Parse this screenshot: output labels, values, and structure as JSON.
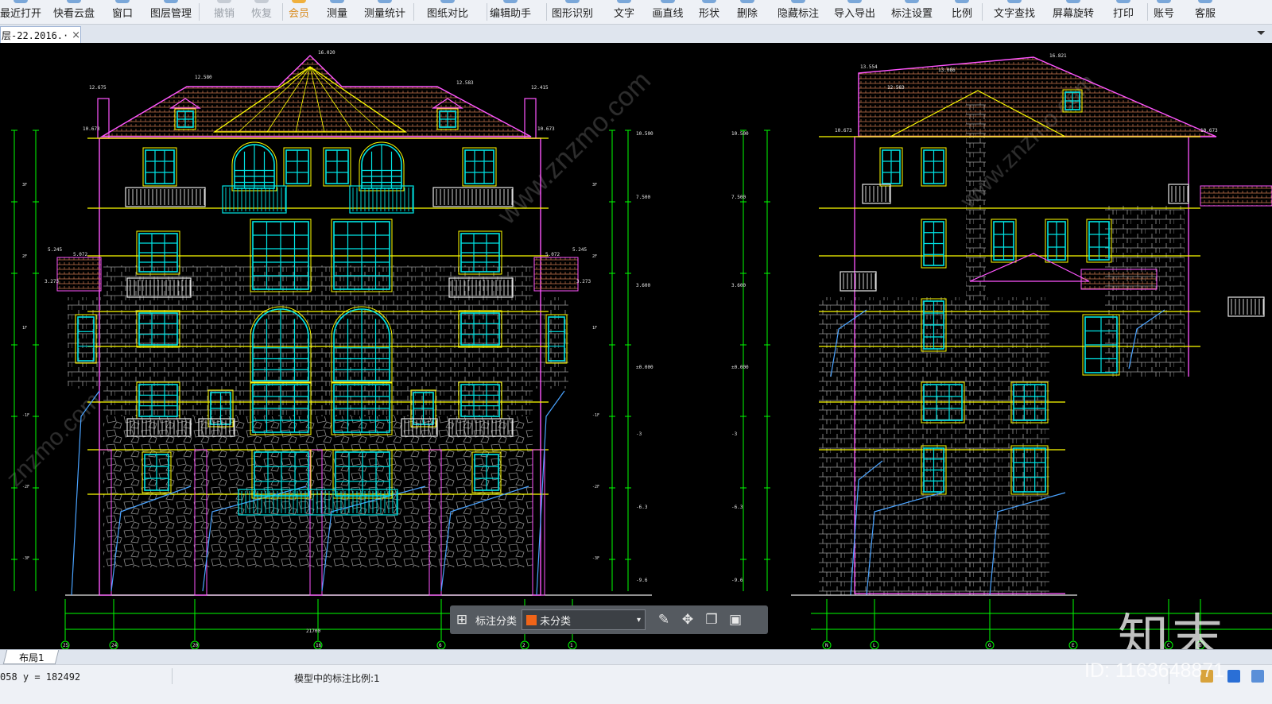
{
  "toolbar": {
    "items": [
      {
        "label": "最近打开",
        "state": "normal"
      },
      {
        "label": "快看云盘",
        "state": "normal"
      },
      {
        "label": "窗口",
        "state": "normal"
      },
      {
        "label": "图层管理",
        "state": "normal"
      },
      {
        "label": "撤销",
        "state": "disabled"
      },
      {
        "label": "恢复",
        "state": "disabled"
      },
      {
        "label": "会员",
        "state": "member"
      },
      {
        "label": "测量",
        "state": "normal"
      },
      {
        "label": "测量统计",
        "state": "normal"
      },
      {
        "label": "图纸对比",
        "state": "normal"
      },
      {
        "label": "编辑助手",
        "state": "normal"
      },
      {
        "label": "图形识别",
        "state": "normal"
      },
      {
        "label": "文字",
        "state": "normal"
      },
      {
        "label": "画直线",
        "state": "normal"
      },
      {
        "label": "形状",
        "state": "normal"
      },
      {
        "label": "删除",
        "state": "normal"
      },
      {
        "label": "隐藏标注",
        "state": "normal"
      },
      {
        "label": "导入导出",
        "state": "normal"
      },
      {
        "label": "标注设置",
        "state": "normal"
      },
      {
        "label": "比例",
        "state": "normal"
      },
      {
        "label": "文字查找",
        "state": "normal"
      },
      {
        "label": "屏幕旋转",
        "state": "normal"
      },
      {
        "label": "打印",
        "state": "normal"
      },
      {
        "label": "账号",
        "state": "normal"
      },
      {
        "label": "客服",
        "state": "normal"
      }
    ]
  },
  "tabs": {
    "document_title": "层-22.2016.·",
    "close_glyph": "×",
    "menu_glyph": "⏷"
  },
  "canvas": {
    "left_drawing_labels": {
      "roof_ridge": "16.020",
      "left_top": "12.675",
      "right_top": "12.415",
      "roof_left": "12.580",
      "roof_right": "12.583",
      "eave_left": "10.673",
      "eave_right": "10.673",
      "floor3": "10.500",
      "floor2": "7.500",
      "floor1": "3.600",
      "ground": "±0.000",
      "basement1": "-3",
      "basement2": "-6.3",
      "basement3": "-9.6",
      "side_left": "5.245",
      "side_right": "5.245",
      "balcony_left": "5.072",
      "balcony_right": "5.072",
      "low_left": "3.273",
      "low_right": "3.273",
      "bottom_width": "21700"
    },
    "right_drawing_labels": {
      "ridge": "16.821",
      "eave_top": "13.554",
      "top2": "13.086",
      "top3": "12.583",
      "left_eave": "10.673",
      "right_eave": "10.673",
      "right_dim_top": "10.500",
      "right_dim_2": "7.500",
      "right_dim_3": "3.600",
      "right_dim_4": "±0.000",
      "right_dim_5": "-3",
      "right_dim_6": "-6.3",
      "right_dim_7": "-9.6"
    },
    "left_axis_labels": [
      "25",
      "24",
      "20",
      "16",
      "6",
      "2",
      "1"
    ],
    "right_axis_labels": [
      "N",
      "L",
      "G",
      "E",
      "C",
      "B"
    ],
    "side_axis_labels": [
      "3F",
      "2F",
      "1F",
      "-1F",
      "-2F",
      "-3F"
    ]
  },
  "annotation_bar": {
    "grid_icon": "grid-icon",
    "label": "标注分类",
    "selected_value": "未分类",
    "swatch_color": "#f06418",
    "caret": "▾"
  },
  "layout_tabs": [
    {
      "label": "布局1"
    }
  ],
  "status": {
    "coordinates": "058 y = 182492",
    "scale_text": "模型中的标注比例:1"
  },
  "watermark": {
    "logo_text": "知末",
    "id_text": "ID: 1163648871"
  },
  "colors": {
    "canvas_bg": "#000000",
    "wall_line": "#e8e8e8",
    "outline": "#ff55ff",
    "window": "#00e5e5",
    "accent_yellow": "#ffff00",
    "dimension_green": "#00ff00",
    "stone": "#8a8a8a"
  }
}
